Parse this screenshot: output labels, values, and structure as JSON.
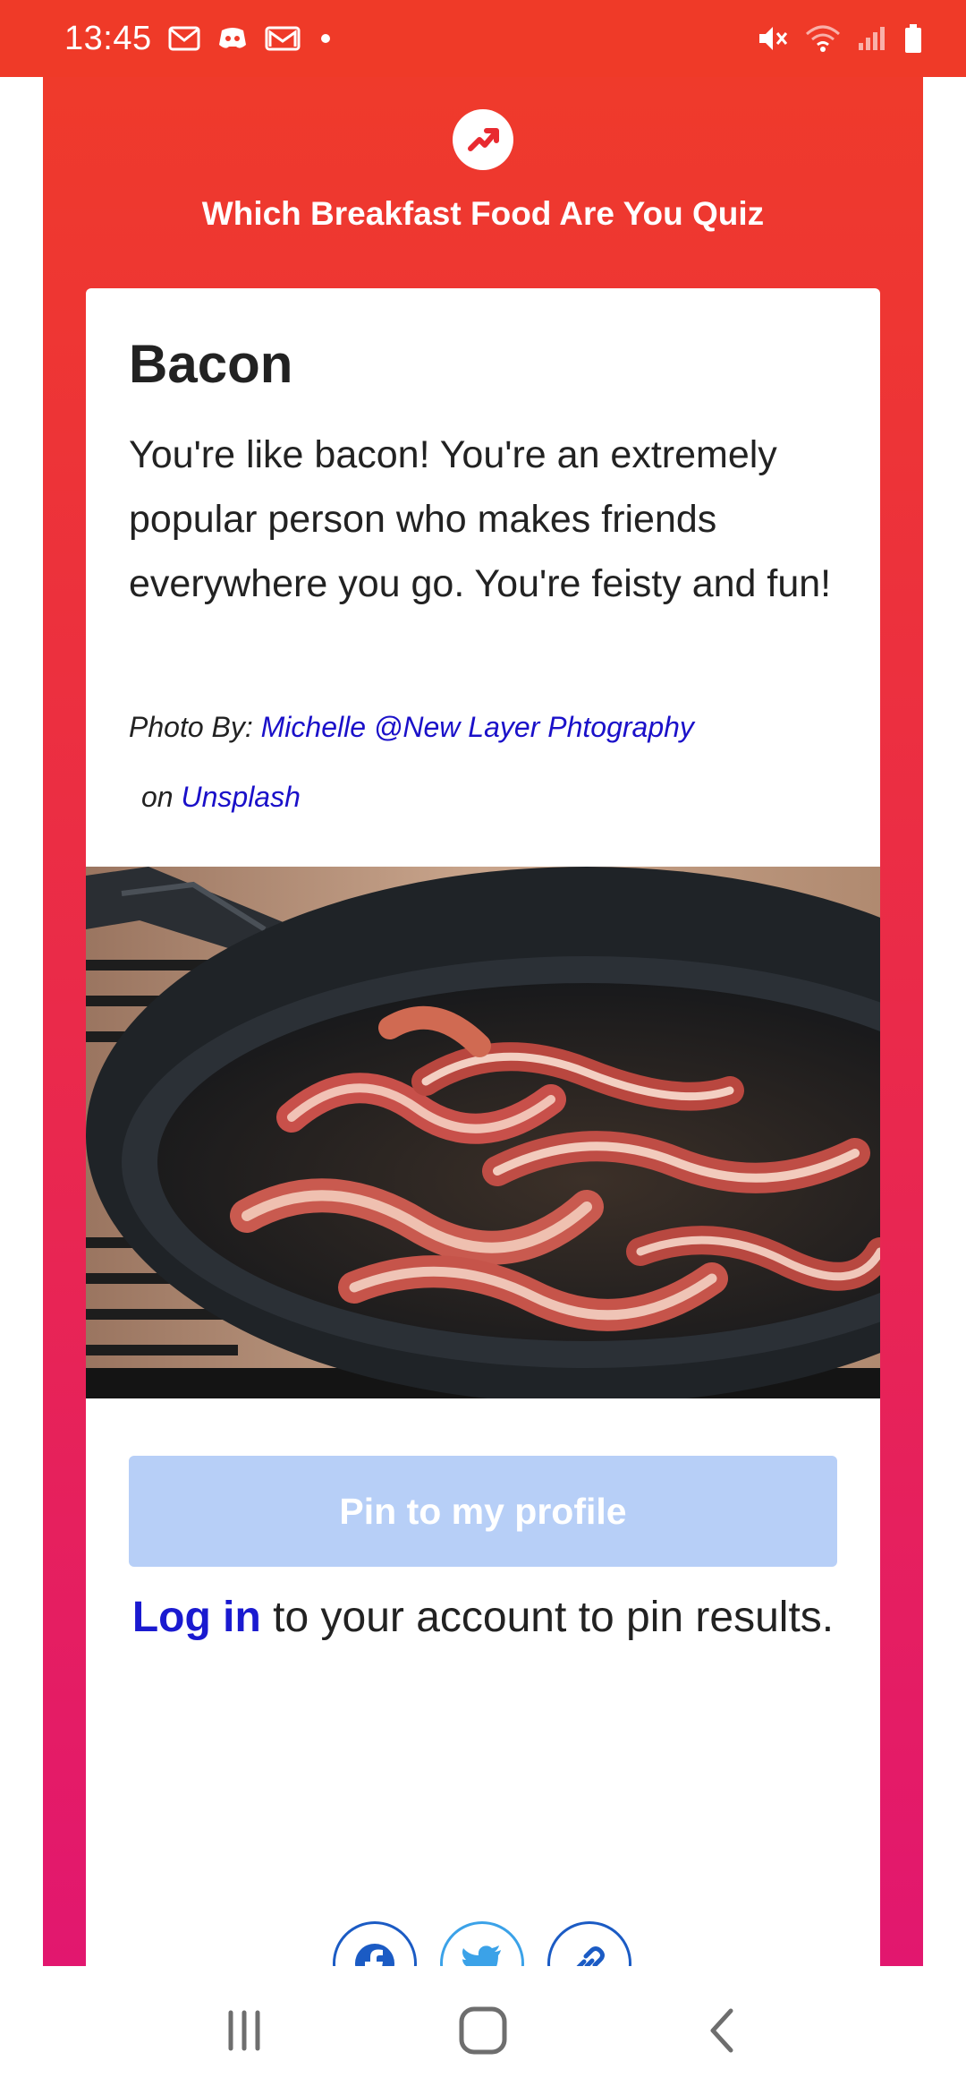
{
  "status_bar": {
    "time": "13:45",
    "left_icons": [
      "mail-icon",
      "discord-icon",
      "gmail-icon",
      "dot-icon"
    ],
    "right_icons": [
      "mute-icon",
      "wifi-icon",
      "signal-icon",
      "battery-icon"
    ]
  },
  "header": {
    "logo_icon": "trending-arrow-icon",
    "title": "Which Breakfast Food Are You Quiz"
  },
  "result": {
    "title": "Bacon",
    "description": "You're like bacon! You're an extremely popular person who makes friends everywhere you go. You're feisty and fun!",
    "credit_prefix": "Photo By:",
    "credit_author": "Michelle @New Layer Phtography",
    "credit_on": "on",
    "credit_source": "Unsplash"
  },
  "actions": {
    "pin_label": "Pin to my profile",
    "login_link": "Log in",
    "login_rest": " to your account to pin results."
  },
  "share": {
    "icons": [
      "facebook-icon",
      "twitter-icon",
      "link-icon"
    ]
  },
  "nav": {
    "icons": [
      "recent-apps-icon",
      "home-icon",
      "back-icon"
    ]
  },
  "colors": {
    "status_bar": "#ef3a28",
    "gradient_top": "#ef3a2b",
    "gradient_bottom": "#e2176f",
    "link": "#1a10c9",
    "pin_button": "#b7cff7",
    "facebook": "#1b5bc4",
    "twitter": "#3ba2e8"
  }
}
